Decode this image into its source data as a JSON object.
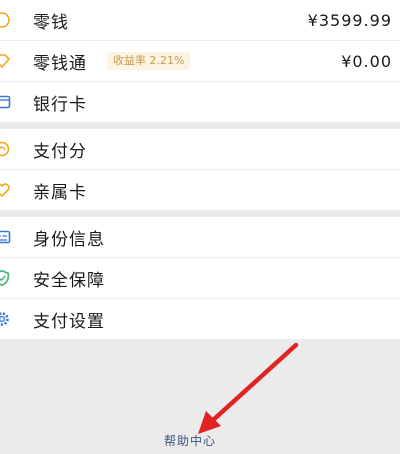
{
  "wallet": {
    "change": {
      "label": "零钱",
      "value": "¥3599.99",
      "icon": "coin-icon"
    },
    "change_pass": {
      "label": "零钱通",
      "badge": "收益率 2.21%",
      "value": "¥0.00",
      "icon": "diamond-icon"
    },
    "bank_card": {
      "label": "银行卡",
      "icon": "card-icon"
    }
  },
  "services": {
    "pay_score": {
      "label": "支付分",
      "icon": "score-icon"
    },
    "family_card": {
      "label": "亲属卡",
      "icon": "heart-icon"
    }
  },
  "settings": {
    "identity": {
      "label": "身份信息",
      "icon": "id-card-icon"
    },
    "security": {
      "label": "安全保障",
      "icon": "shield-icon"
    },
    "pay_settings": {
      "label": "支付设置",
      "icon": "gear-icon"
    }
  },
  "footer": {
    "help_center": "帮助中心"
  },
  "colors": {
    "icon_orange": "#f5a623",
    "icon_blue": "#3a7bd5",
    "icon_green": "#3cb371",
    "arrow_red": "#e02424"
  }
}
